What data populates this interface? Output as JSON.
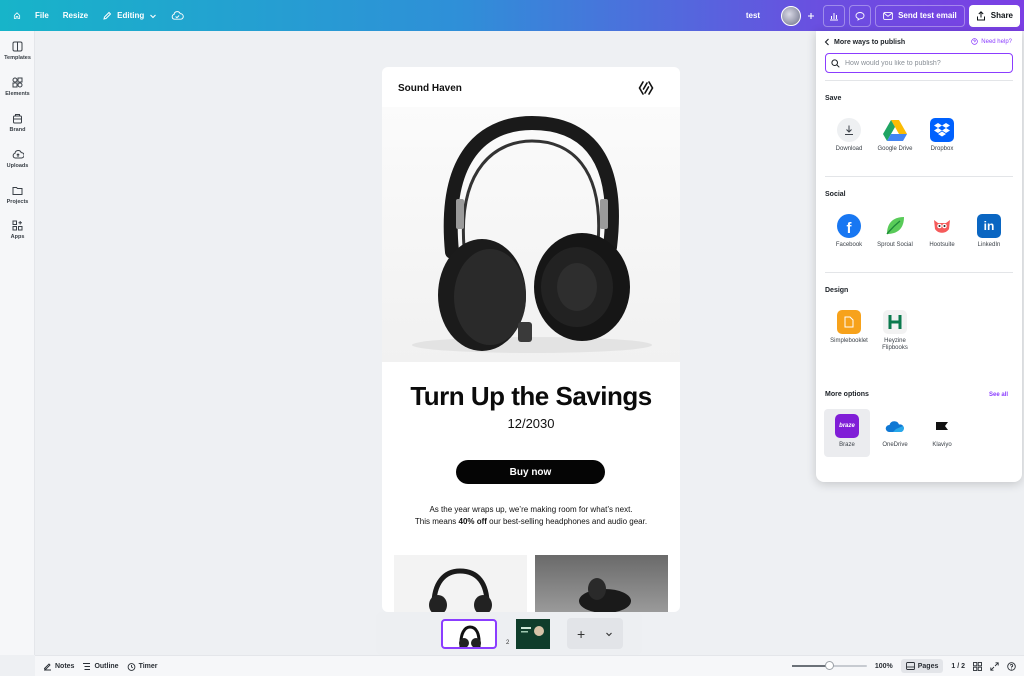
{
  "topbar": {
    "file": "File",
    "resize": "Resize",
    "editing": "Editing",
    "doc_title": "test",
    "send_test_email": "Send test email",
    "share": "Share"
  },
  "rail": [
    {
      "label": "Templates",
      "icon": "templates-icon"
    },
    {
      "label": "Elements",
      "icon": "elements-icon"
    },
    {
      "label": "Brand",
      "icon": "brand-icon"
    },
    {
      "label": "Uploads",
      "icon": "uploads-icon"
    },
    {
      "label": "Projects",
      "icon": "projects-icon"
    },
    {
      "label": "Apps",
      "icon": "apps-icon"
    }
  ],
  "design": {
    "brand": "Sound Haven",
    "headline": "Turn Up the Savings",
    "date": "12/2030",
    "buy_label": "Buy now",
    "copy_line1": "As the year wraps up, we’re making room for what’s next.",
    "copy_line2_pre": "This means ",
    "copy_line2_bold": "40% off",
    "copy_line2_post": " our best-selling headphones and audio gear."
  },
  "pages": {
    "page1": "1",
    "page2": "2",
    "add": "+"
  },
  "bottombar": {
    "notes": "Notes",
    "outline": "Outline",
    "timer": "Timer",
    "zoom": "100%",
    "zoom_level": 0.5,
    "pages": "Pages",
    "page_count": "1 / 2"
  },
  "panel": {
    "title": "More ways to publish",
    "help": "Need help?",
    "search_placeholder": "How would you like to publish?",
    "sections": {
      "save": {
        "title": "Save",
        "items": [
          "Download",
          "Google Drive",
          "Dropbox"
        ]
      },
      "social": {
        "title": "Social",
        "items": [
          "Facebook",
          "Sprout Social",
          "Hootsuite",
          "LinkedIn"
        ]
      },
      "design": {
        "title": "Design",
        "items": [
          "Simplebooklet",
          "Heyzine Flipbooks"
        ]
      },
      "more": {
        "title": "More options",
        "see_all": "See all",
        "items": [
          "Braze",
          "OneDrive",
          "Klaviyo"
        ],
        "braze_logo": "braze"
      }
    }
  },
  "colors": {
    "accent": "#8b3dff",
    "gradient_start": "#17b4c9",
    "gradient_end": "#7b3fe4"
  }
}
